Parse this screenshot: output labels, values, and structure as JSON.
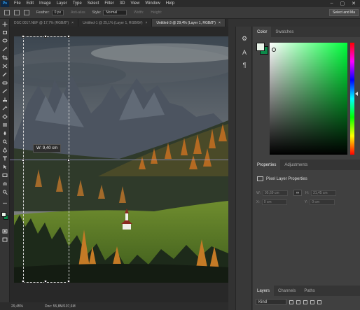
{
  "app": {
    "logo_text": "Ps"
  },
  "menu": [
    "File",
    "Edit",
    "Image",
    "Layer",
    "Type",
    "Select",
    "Filter",
    "3D",
    "View",
    "Window",
    "Help"
  ],
  "window_controls": [
    "–",
    "▢",
    "✕"
  ],
  "options_bar": {
    "feather_label": "Feather:",
    "feather_value": "0 px",
    "antialias_label": "Anti-alias",
    "style_label": "Style:",
    "style_value": "Normal",
    "width_label": "Width:",
    "height_label": "Height:",
    "select_mask_label": "Select and Ma"
  },
  "tabs": [
    {
      "label": "DSC 0017.NEF @ 17,7% (RGB/8*)",
      "close": "×"
    },
    {
      "label": "Untitled-1 @ 25,1% (Layer 1, RGB/8#)",
      "close": "×"
    },
    {
      "label": "Untitled-3 @ 29,4% (Layer 1, RGB/8*)",
      "close": "×"
    }
  ],
  "canvas": {
    "measure_tooltip": "W: 9,40 cm"
  },
  "status": {
    "zoom": "29,45%",
    "doc": "Doc: 55,8M/107,6M"
  },
  "color_panel": {
    "tabs": [
      "Color",
      "Swatches"
    ],
    "foreground": "#e8f3e8",
    "background": "#0c8a4a"
  },
  "properties_panel": {
    "tabs": [
      "Properties",
      "Adjustments"
    ],
    "title": "Pixel Layer Properties",
    "w_label": "W:",
    "w_value": "95,69 cm",
    "h_label": "H:",
    "h_value": "31,45 cm",
    "x_label": "X:",
    "x_value": "0 cm",
    "y_label": "Y:",
    "y_value": "0 cm",
    "link_icon": "∞"
  },
  "layers_panel": {
    "tabs": [
      "Layers",
      "Channels",
      "Paths"
    ],
    "filter_value": "Kind"
  }
}
